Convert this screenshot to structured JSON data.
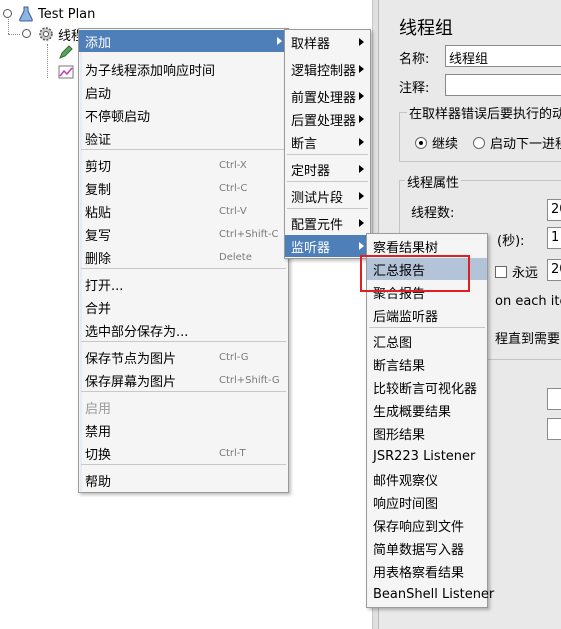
{
  "tree": {
    "root_label": "Test Plan",
    "child_label": "线程组"
  },
  "right_panel": {
    "title": "线程组",
    "name_label": "名称:",
    "name_value": "线程组",
    "comment_label": "注释:",
    "error_group_title": "在取样器错误后要执行的动",
    "radio_continue": "继续",
    "radio_next_loop": "启动下一进程",
    "thread_props_title": "线程属性",
    "thread_count_label": "线程数:",
    "thread_count_value": "20",
    "rampup_label": "(秒):",
    "rampup_value": "1",
    "forever_label": "永远",
    "loop_value": "20",
    "same_user_text": "on each iter",
    "delay_text": "程直到需要"
  },
  "context_menu": {
    "items": [
      {
        "label": "添加",
        "submenu": true
      },
      {
        "label": "为子线程添加响应时间"
      },
      {
        "label": "启动"
      },
      {
        "label": "不停顿启动"
      },
      {
        "label": "验证"
      },
      {
        "label": "剪切",
        "shortcut": "Ctrl-X"
      },
      {
        "label": "复制",
        "shortcut": "Ctrl-C"
      },
      {
        "label": "粘贴",
        "shortcut": "Ctrl-V"
      },
      {
        "label": "复写",
        "shortcut": "Ctrl+Shift-C"
      },
      {
        "label": "删除",
        "shortcut": "Delete"
      },
      {
        "label": "打开..."
      },
      {
        "label": "合并"
      },
      {
        "label": "选中部分保存为..."
      },
      {
        "label": "保存节点为图片",
        "shortcut": "Ctrl-G"
      },
      {
        "label": "保存屏幕为图片",
        "shortcut": "Ctrl+Shift-G"
      },
      {
        "label": "启用",
        "disabled": true
      },
      {
        "label": "禁用"
      },
      {
        "label": "切换",
        "shortcut": "Ctrl-T"
      },
      {
        "label": "帮助"
      }
    ]
  },
  "add_menu": {
    "items": [
      {
        "label": "取样器"
      },
      {
        "label": "逻辑控制器"
      },
      {
        "label": "前置处理器"
      },
      {
        "label": "后置处理器"
      },
      {
        "label": "断言"
      },
      {
        "label": "定时器"
      },
      {
        "label": "测试片段"
      },
      {
        "label": "配置元件"
      },
      {
        "label": "监听器"
      }
    ]
  },
  "listener_menu": {
    "items": [
      {
        "label": "察看结果树"
      },
      {
        "label": "汇总报告"
      },
      {
        "label": "聚合报告"
      },
      {
        "label": "后端监听器"
      },
      {
        "label": "汇总图"
      },
      {
        "label": "断言结果"
      },
      {
        "label": "比较断言可视化器"
      },
      {
        "label": "生成概要结果"
      },
      {
        "label": "图形结果"
      },
      {
        "label": "JSR223 Listener"
      },
      {
        "label": "邮件观察仪"
      },
      {
        "label": "响应时间图"
      },
      {
        "label": "保存响应到文件"
      },
      {
        "label": "简单数据写入器"
      },
      {
        "label": "用表格察看结果"
      },
      {
        "label": "BeanShell Listener"
      }
    ]
  },
  "colors": {
    "menu_active": "#4e7fb8",
    "menu_hover": "#b4c4d8",
    "annotation_box": "#e02020"
  }
}
